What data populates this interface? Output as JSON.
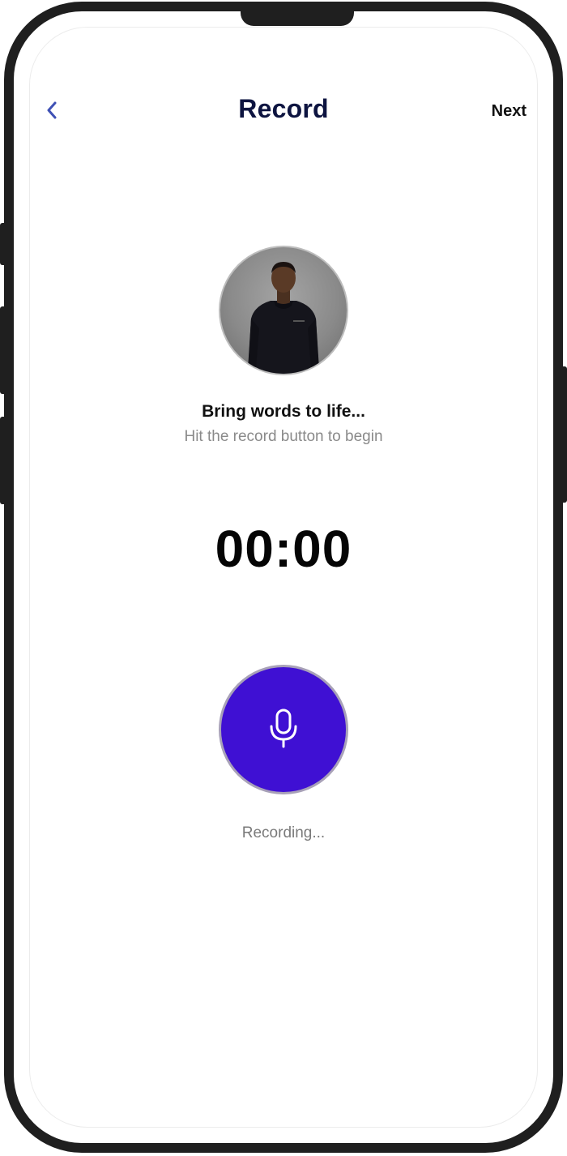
{
  "header": {
    "title": "Record",
    "next_label": "Next",
    "back_icon": "chevron-left-icon"
  },
  "colors": {
    "accent": "#3f51b5",
    "title": "#0d1440",
    "record_button": "#3f10d3",
    "muted_text": "#8a8a8a"
  },
  "prompt": {
    "headline": "Bring words to life...",
    "subline": "Hit the record button to begin"
  },
  "timer": {
    "value": "00:00"
  },
  "recorder": {
    "icon": "microphone-icon",
    "status": "Recording..."
  },
  "avatar": {
    "icon": "user-photo"
  }
}
